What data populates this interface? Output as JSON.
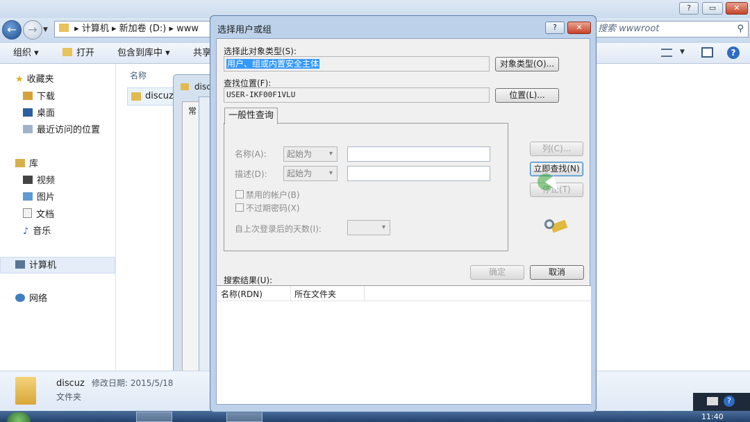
{
  "explorer": {
    "window_buttons": [
      "?",
      "▭",
      "✕"
    ],
    "address": {
      "sep1": "▸",
      "seg1": "计算机",
      "sep2": "▸",
      "seg2": "新加卷 (D:)",
      "sep3": "▸",
      "seg3": "www"
    },
    "search_placeholder": "搜索 wwwroot",
    "toolbar": {
      "organize": "组织 ▾",
      "open": "打开",
      "include": "包含到库中 ▾",
      "share": "共享"
    },
    "nav": {
      "favorites": "收藏夹",
      "downloads": "下载",
      "desktop": "桌面",
      "recent": "最近访问的位置",
      "libraries": "库",
      "videos": "视频",
      "pictures": "图片",
      "documents": "文档",
      "music": "音乐",
      "computer": "计算机",
      "network": "网络"
    },
    "content": {
      "column_name": "名称",
      "folder_name": "discuz"
    },
    "details": {
      "name": "discuz",
      "modified": "修改日期: 2015/5/18",
      "type": "文件夹"
    },
    "taskbar_time": "11:40"
  },
  "background_windows": {
    "title": "disc",
    "tab_label": "常"
  },
  "dialog": {
    "title": "选择用户或组",
    "help": "?",
    "close": "✕",
    "object_type_label": "选择此对象类型(S):",
    "object_type_value": "用户、组或内置安全主体",
    "object_types_button": "对象类型(O)...",
    "location_label": "查找位置(F):",
    "location_value": "USER-IKF00F1VLU",
    "locations_button": "位置(L)...",
    "tab": "一般性查询",
    "name_label": "名称(A):",
    "name_mode": "起始为",
    "desc_label": "描述(D):",
    "desc_mode": "起始为",
    "disabled_accounts": "禁用的帐户(B)",
    "non_expiring": "不过期密码(X)",
    "days_label": "自上次登录后的天数(I):",
    "columns_button": "列(C)...",
    "find_now_button": "立即查找(N)",
    "stop_button": "停止(T)",
    "ok_button": "确定",
    "cancel_button": "取消",
    "results_label": "搜索结果(U):",
    "result_columns": [
      "名称(RDN)",
      "所在文件夹"
    ]
  }
}
